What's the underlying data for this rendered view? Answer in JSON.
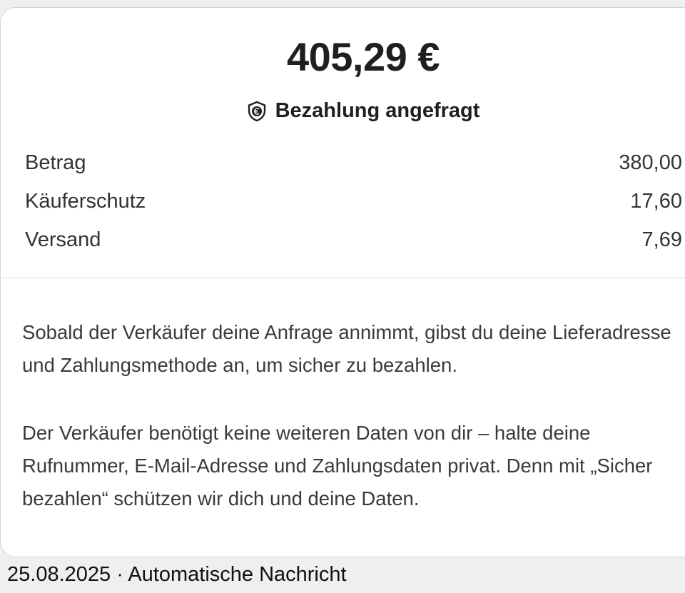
{
  "summary": {
    "total": "405,29 €",
    "status_label": "Bezahlung angefragt",
    "status_icon": "euro-shield-icon"
  },
  "breakdown": [
    {
      "label": "Betrag",
      "value": "380,00"
    },
    {
      "label": "Käuferschutz",
      "value": "17,60"
    },
    {
      "label": "Versand",
      "value": "7,69"
    }
  ],
  "info": {
    "paragraph1": "Sobald der Verkäufer deine Anfrage annimmt, gibst du deine Lieferadresse und Zahlungsmethode an, um sicher zu bezahlen.",
    "paragraph2": "Der Verkäufer benötigt keine weiteren Daten von dir – halte deine Rufnummer, E-Mail-Adresse und Zahlungsdaten privat. Denn mit „Sicher bezahlen“ schützen wir dich und deine Daten."
  },
  "footer": {
    "text": "25.08.2025 · Automatische Nachricht"
  }
}
